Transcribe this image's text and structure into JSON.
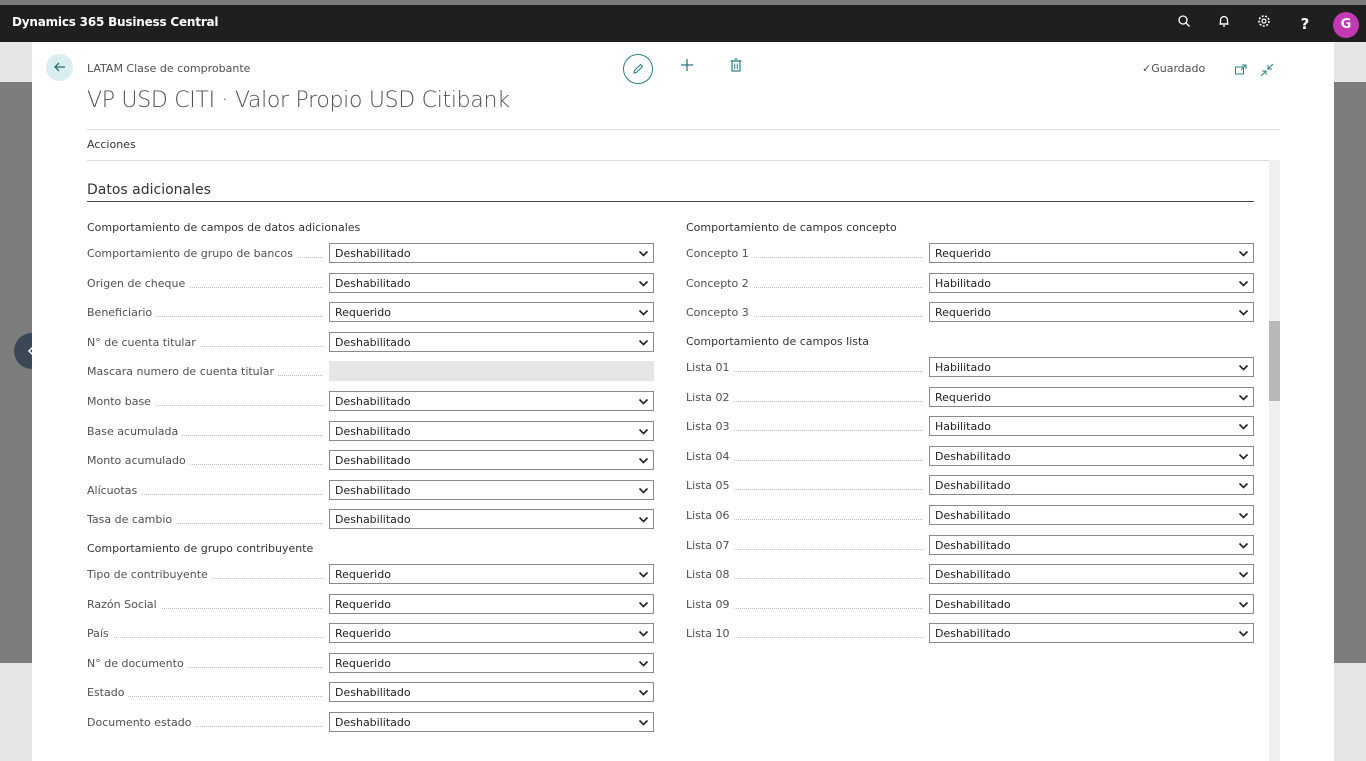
{
  "app": {
    "title": "Dynamics 365 Business Central",
    "user_initial": "G"
  },
  "header": {
    "caption": "LATAM Clase de comprobante",
    "title": "VP USD CITI · Valor Propio USD Citibank",
    "saved_label": "Guardado",
    "actions_label": "Acciones"
  },
  "section": {
    "title": "Datos adicionales"
  },
  "groups": {
    "left1": "Comportamiento de campos de datos adicionales",
    "left2": "Comportamiento de grupo contribuyente",
    "right1": "Comportamiento de campos concepto",
    "right2": "Comportamiento de campos lista"
  },
  "left_fields_1": [
    {
      "label": "Comportamiento de grupo de bancos",
      "value": "Deshabilitado"
    },
    {
      "label": "Origen de cheque",
      "value": "Deshabilitado"
    },
    {
      "label": "Beneficiario",
      "value": "Requerido"
    },
    {
      "label": "N° de cuenta titular",
      "value": "Deshabilitado"
    },
    {
      "label": "Mascara numero de cuenta titular",
      "value": ""
    },
    {
      "label": "Monto base",
      "value": "Deshabilitado"
    },
    {
      "label": "Base acumulada",
      "value": "Deshabilitado"
    },
    {
      "label": "Monto acumulado",
      "value": "Deshabilitado"
    },
    {
      "label": "Alícuotas",
      "value": "Deshabilitado"
    },
    {
      "label": "Tasa de cambio",
      "value": "Deshabilitado"
    }
  ],
  "left_fields_2": [
    {
      "label": "Tipo de contribuyente",
      "value": "Requerido"
    },
    {
      "label": "Razón Social",
      "value": "Requerido"
    },
    {
      "label": "País",
      "value": "Requerido"
    },
    {
      "label": "N° de documento",
      "value": "Requerido"
    },
    {
      "label": "Estado",
      "value": "Deshabilitado"
    },
    {
      "label": "Documento estado",
      "value": "Deshabilitado"
    }
  ],
  "right_fields_1": [
    {
      "label": "Concepto 1",
      "value": "Requerido"
    },
    {
      "label": "Concepto 2",
      "value": "Habilitado"
    },
    {
      "label": "Concepto 3",
      "value": "Requerido"
    }
  ],
  "right_fields_2": [
    {
      "label": "Lista 01",
      "value": "Habilitado"
    },
    {
      "label": "Lista 02",
      "value": "Requerido"
    },
    {
      "label": "Lista 03",
      "value": "Habilitado"
    },
    {
      "label": "Lista 04",
      "value": "Deshabilitado"
    },
    {
      "label": "Lista 05",
      "value": "Deshabilitado"
    },
    {
      "label": "Lista 06",
      "value": "Deshabilitado"
    },
    {
      "label": "Lista 07",
      "value": "Deshabilitado"
    },
    {
      "label": "Lista 08",
      "value": "Deshabilitado"
    },
    {
      "label": "Lista 09",
      "value": "Deshabilitado"
    },
    {
      "label": "Lista 10",
      "value": "Deshabilitado"
    }
  ]
}
